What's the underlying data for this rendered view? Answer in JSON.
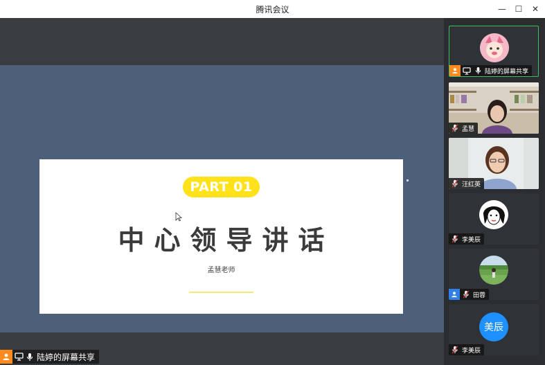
{
  "window": {
    "title": "腾讯会议",
    "minimize": "—",
    "maximize": "☐",
    "close": "✕"
  },
  "slide": {
    "badge": "PART 01",
    "title": "中心领导讲话",
    "subtitle": "孟慧老师"
  },
  "share_tag": {
    "label": "陆婷的屏幕共享"
  },
  "participants": [
    {
      "label": "陆婷的屏幕共享",
      "kind": "avatar-cartoon"
    },
    {
      "label": "孟慧",
      "kind": "video"
    },
    {
      "label": "汪红英",
      "kind": "video"
    },
    {
      "label": "李美辰",
      "kind": "avatar-sketch"
    },
    {
      "label": "田蓉",
      "kind": "avatar-photo"
    },
    {
      "label": "李美辰",
      "kind": "avatar-text",
      "avatar_text": "美辰"
    }
  ],
  "colors": {
    "active_border": "#3fbf5f",
    "badge_yellow": "#ffe21c",
    "host_orange": "#ff8a1f",
    "blue": "#2f7fe6"
  }
}
